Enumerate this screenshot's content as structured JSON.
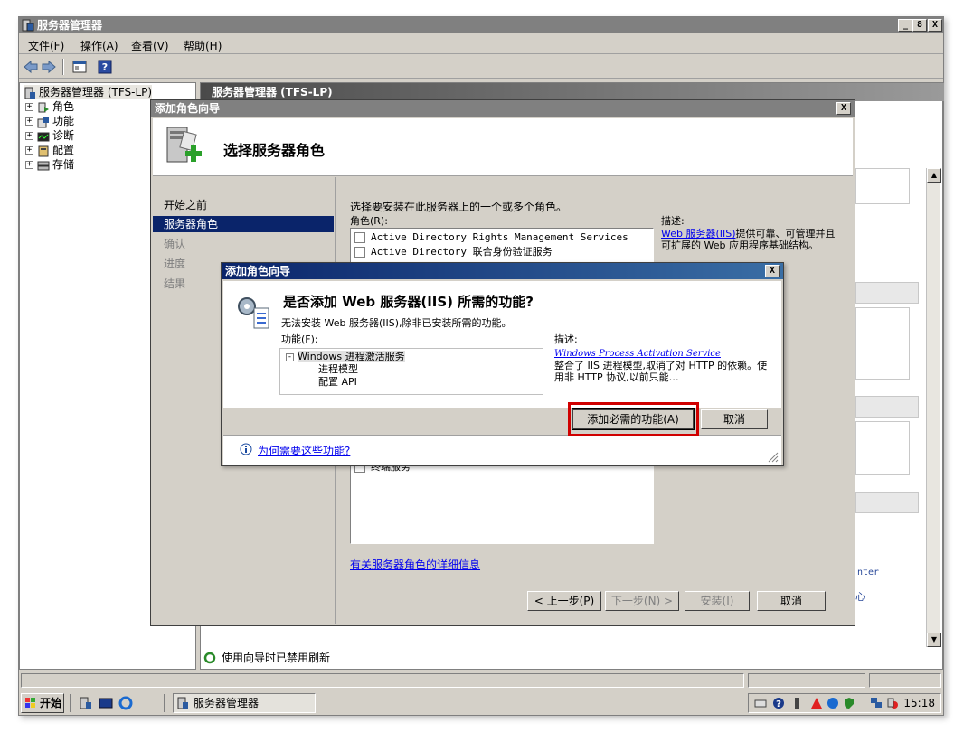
{
  "app": {
    "title": "服务器管理器",
    "caption_buttons": [
      "_",
      "8",
      "X"
    ]
  },
  "menu": [
    "文件(F)",
    "操作(A)",
    "查看(V)",
    "帮助(H)"
  ],
  "tree": {
    "root": "服务器管理器 (TFS-LP)",
    "items": [
      "角色",
      "功能",
      "诊断",
      "配置",
      "存储"
    ]
  },
  "main": {
    "header": "服务器管理器 (TFS-LP)",
    "right_fragments": [
      "nter",
      "心"
    ],
    "status": "使用向导时已禁用刷新"
  },
  "wizard": {
    "window_title": "添加角色向导",
    "heading": "选择服务器角色",
    "nav": [
      {
        "label": "开始之前",
        "state": "normal"
      },
      {
        "label": "服务器角色",
        "state": "selected"
      },
      {
        "label": "确认",
        "state": "dim"
      },
      {
        "label": "进度",
        "state": "dim"
      },
      {
        "label": "结果",
        "state": "dim"
      }
    ],
    "intro": "选择要安装在此服务器上的一个或多个角色。",
    "roles_label": "角色(R):",
    "roles": [
      "Active Directory Rights Management Services",
      "Active Directory 联合身份验证服务"
    ],
    "roles_bottom": [
      "终端服务"
    ],
    "desc_label": "描述:",
    "desc_link": "Web 服务器(IIS)",
    "desc_text": "提供可靠、可管理并且可扩展的 Web 应用程序基础结构。",
    "more_link": "有关服务器角色的详细信息",
    "buttons": {
      "prev": "< 上一步(P)",
      "next": "下一步(N) >",
      "install": "安装(I)",
      "cancel": "取消"
    }
  },
  "modal": {
    "window_title": "添加角色向导",
    "question": "是否添加 Web 服务器(IIS) 所需的功能?",
    "sub": "无法安装 Web 服务器(IIS),除非已安装所需的功能。",
    "features_label": "功能(F):",
    "features": {
      "parent": "Windows 进程激活服务",
      "children": [
        "进程模型",
        "配置 API"
      ]
    },
    "desc_label": "描述:",
    "desc_link": "Windows Process Activation Service",
    "desc_text": "整合了 IIS 进程模型,取消了对 HTTP 的依赖。使用非 HTTP 协议,以前只能…",
    "add_button": "添加必需的功能(A)",
    "cancel_button": "取消",
    "why_link": "为何需要这些功能?",
    "highlight_color": "#d00000"
  },
  "taskbar": {
    "start": "开始",
    "task": "服务器管理器",
    "clock": "15:18"
  }
}
